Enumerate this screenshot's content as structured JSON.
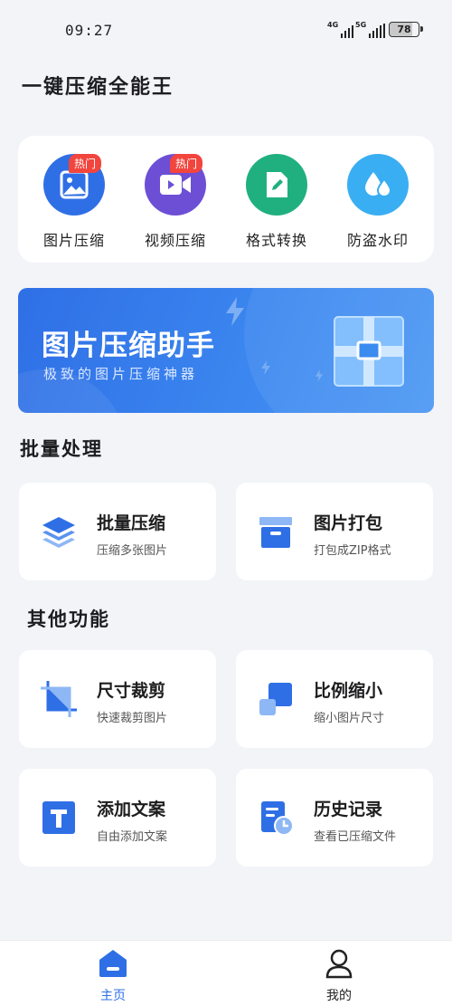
{
  "status": {
    "time": "09:27",
    "net1": "4G",
    "net2": "5G",
    "battery": "78"
  },
  "app_title": "一键压缩全能王",
  "tools": [
    {
      "label": "图片压缩",
      "badge": "热门",
      "color": "#2f6fe6",
      "icon": "image-icon"
    },
    {
      "label": "视频压缩",
      "badge": "热门",
      "color": "#6d4fd6",
      "icon": "video-camera-icon"
    },
    {
      "label": "格式转换",
      "badge": "",
      "color": "#20b07f",
      "icon": "edit-icon"
    },
    {
      "label": "防盗水印",
      "badge": "",
      "color": "#3aaef2",
      "icon": "water-drop-icon"
    }
  ],
  "banner": {
    "title": "图片压缩助手",
    "subtitle": "极致的图片压缩神器"
  },
  "sections": {
    "batch": "批量处理",
    "other": "其他功能"
  },
  "features": [
    {
      "title": "批量压缩",
      "subtitle": "压缩多张图片",
      "icon": "layers-icon"
    },
    {
      "title": "图片打包",
      "subtitle": "打包成ZIP格式",
      "icon": "archive-box-icon"
    },
    {
      "title": "尺寸裁剪",
      "subtitle": "快速裁剪图片",
      "icon": "crop-icon"
    },
    {
      "title": "比例缩小",
      "subtitle": "缩小图片尺寸",
      "icon": "scale-down-icon"
    },
    {
      "title": "添加文案",
      "subtitle": "自由添加文案",
      "icon": "text-icon"
    },
    {
      "title": "历史记录",
      "subtitle": "查看已压缩文件",
      "icon": "history-document-icon"
    }
  ],
  "nav": {
    "home": "主页",
    "mine": "我的",
    "active_color": "#2f6fe6"
  },
  "colors": {
    "accent": "#2f6fe6",
    "badge": "#f2453d",
    "background": "#f3f4f8"
  }
}
